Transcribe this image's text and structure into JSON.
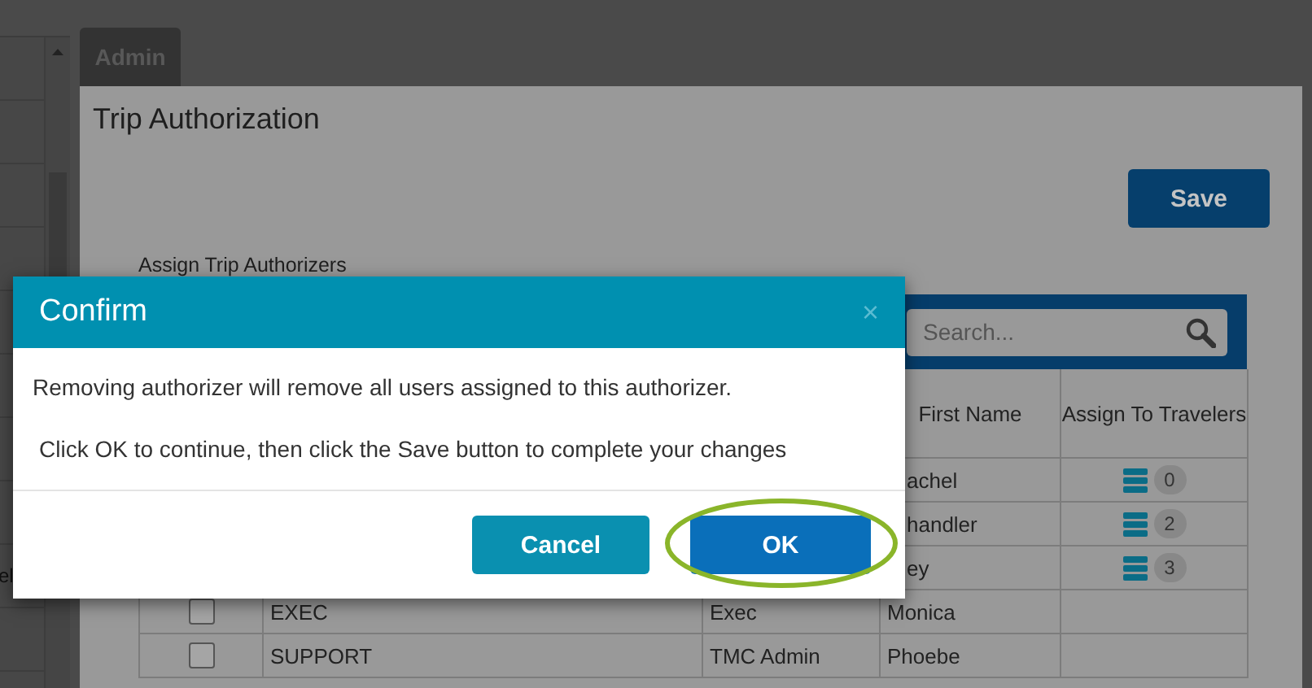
{
  "left_panel": {
    "fragment": "el"
  },
  "tab": {
    "label": "Admin"
  },
  "page": {
    "title": "Trip Authorization",
    "save_button": "Save",
    "section_label": "Assign Trip Authorizers"
  },
  "table": {
    "search": {
      "placeholder": "Search..."
    },
    "columns": [
      {
        "label": "First Name"
      },
      {
        "label": "Assign To Travelers"
      }
    ],
    "rows": [
      {
        "first_name": "achel",
        "clipped": true,
        "travelers": "0"
      },
      {
        "first_name": "handler",
        "clipped": true,
        "travelers": "2"
      },
      {
        "first_name": "ey",
        "clipped": true,
        "travelers": "3"
      },
      {
        "checked": false,
        "code": "EXEC",
        "role": "Exec",
        "first_name": "Monica"
      },
      {
        "checked": false,
        "code": "SUPPORT",
        "role": "TMC Admin",
        "first_name": "Phoebe"
      }
    ]
  },
  "dialog": {
    "title": "Confirm",
    "close": "×",
    "messages": [
      "Removing authorizer will remove all users assigned to this authorizer.",
      "Click OK to continue, then click the Save button to complete your changes"
    ],
    "buttons": [
      {
        "label": "Cancel",
        "kind": "secondary",
        "highlighted": false
      },
      {
        "label": "OK",
        "kind": "primary",
        "highlighted": true
      }
    ]
  }
}
